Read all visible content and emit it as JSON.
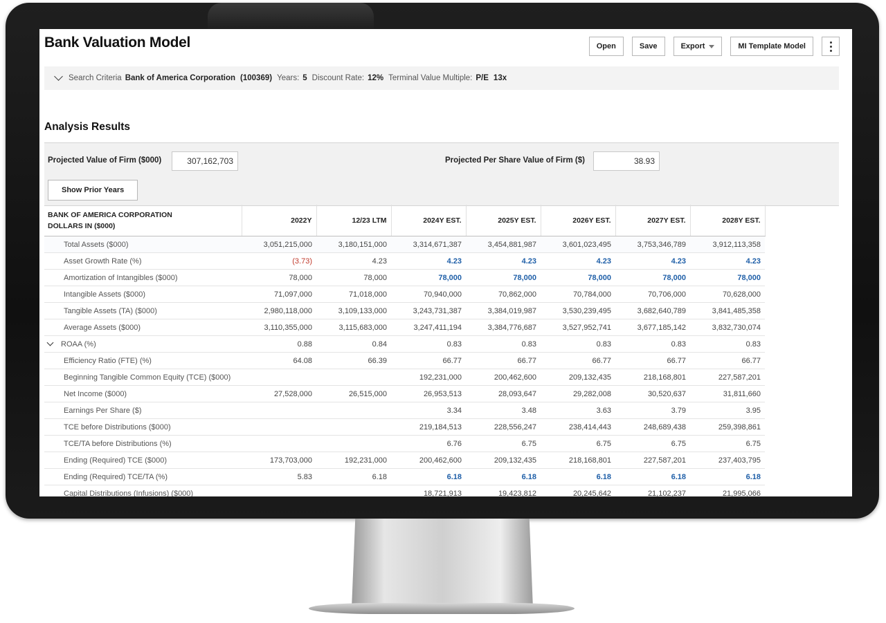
{
  "app": {
    "title": "Bank Valuation Model"
  },
  "toolbar": {
    "open": "Open",
    "save": "Save",
    "export": "Export",
    "template": "MI Template Model"
  },
  "criteria": {
    "label": "Search Criteria",
    "company": "Bank of America Corporation",
    "company_id": "(100369)",
    "years_label": "Years:",
    "years": "5",
    "discount_label": "Discount Rate:",
    "discount": "12%",
    "terminal_label": "Terminal Value Multiple:",
    "terminal_type": "P/E",
    "terminal_value": "13x"
  },
  "analysis": {
    "title": "Analysis Results",
    "firm_value_label": "Projected Value of Firm ($000)",
    "firm_value": "307,162,703",
    "per_share_label": "Projected Per Share Value of Firm ($)",
    "per_share": "38.93",
    "show_prior": "Show Prior Years"
  },
  "table": {
    "corp_name": "BANK OF AMERICA CORPORATION",
    "units": "DOLLARS IN ($000)",
    "columns": [
      "2022Y",
      "12/23 LTM",
      "2024Y EST.",
      "2025Y EST.",
      "2026Y EST.",
      "2027Y EST.",
      "2028Y EST."
    ],
    "rows": [
      {
        "name": "Total Assets ($000)",
        "values": [
          "3,051,215,000",
          "3,180,151,000",
          "3,314,671,387",
          "3,454,881,987",
          "3,601,023,495",
          "3,753,346,789",
          "3,912,113,358"
        ]
      },
      {
        "name": "Asset Growth Rate (%)",
        "values": [
          "(3.73)",
          "4.23",
          "4.23",
          "4.23",
          "4.23",
          "4.23",
          "4.23"
        ]
      },
      {
        "name": "Amortization of Intangibles ($000)",
        "values": [
          "78,000",
          "78,000",
          "78,000",
          "78,000",
          "78,000",
          "78,000",
          "78,000"
        ]
      },
      {
        "name": "Intangible Assets ($000)",
        "values": [
          "71,097,000",
          "71,018,000",
          "70,940,000",
          "70,862,000",
          "70,784,000",
          "70,706,000",
          "70,628,000"
        ]
      },
      {
        "name": "Tangible Assets (TA) ($000)",
        "values": [
          "2,980,118,000",
          "3,109,133,000",
          "3,243,731,387",
          "3,384,019,987",
          "3,530,239,495",
          "3,682,640,789",
          "3,841,485,358"
        ]
      },
      {
        "name": "Average Assets ($000)",
        "values": [
          "3,110,355,000",
          "3,115,683,000",
          "3,247,411,194",
          "3,384,776,687",
          "3,527,952,741",
          "3,677,185,142",
          "3,832,730,074"
        ]
      },
      {
        "name": "ROAA (%)",
        "values": [
          "0.88",
          "0.84",
          "0.83",
          "0.83",
          "0.83",
          "0.83",
          "0.83"
        ]
      },
      {
        "name": "Efficiency Ratio (FTE) (%)",
        "values": [
          "64.08",
          "66.39",
          "66.77",
          "66.77",
          "66.77",
          "66.77",
          "66.77"
        ]
      },
      {
        "name": "Beginning Tangible Common Equity (TCE) ($000)",
        "values": [
          "",
          "",
          "192,231,000",
          "200,462,600",
          "209,132,435",
          "218,168,801",
          "227,587,201"
        ]
      },
      {
        "name": "Net Income ($000)",
        "values": [
          "27,528,000",
          "26,515,000",
          "26,953,513",
          "28,093,647",
          "29,282,008",
          "30,520,637",
          "31,811,660"
        ]
      },
      {
        "name": "Earnings Per Share ($)",
        "values": [
          "",
          "",
          "3.34",
          "3.48",
          "3.63",
          "3.79",
          "3.95"
        ]
      },
      {
        "name": "TCE before Distributions ($000)",
        "values": [
          "",
          "",
          "219,184,513",
          "228,556,247",
          "238,414,443",
          "248,689,438",
          "259,398,861"
        ]
      },
      {
        "name": "TCE/TA before Distributions (%)",
        "values": [
          "",
          "",
          "6.76",
          "6.75",
          "6.75",
          "6.75",
          "6.75"
        ]
      },
      {
        "name": "Ending (Required) TCE ($000)",
        "values": [
          "173,703,000",
          "192,231,000",
          "200,462,600",
          "209,132,435",
          "218,168,801",
          "227,587,201",
          "237,403,795"
        ]
      },
      {
        "name": "Ending (Required) TCE/TA (%)",
        "values": [
          "5.83",
          "6.18",
          "6.18",
          "6.18",
          "6.18",
          "6.18",
          "6.18"
        ]
      },
      {
        "name": "Capital Distributions (Infusions) ($000)",
        "values": [
          "",
          "",
          "18,721,913",
          "19,423,812",
          "20,245,642",
          "21,102,237",
          "21,995,066"
        ]
      }
    ]
  },
  "colors": {
    "negative": "#c0392b",
    "estimate_input": "#1f5fa8"
  }
}
